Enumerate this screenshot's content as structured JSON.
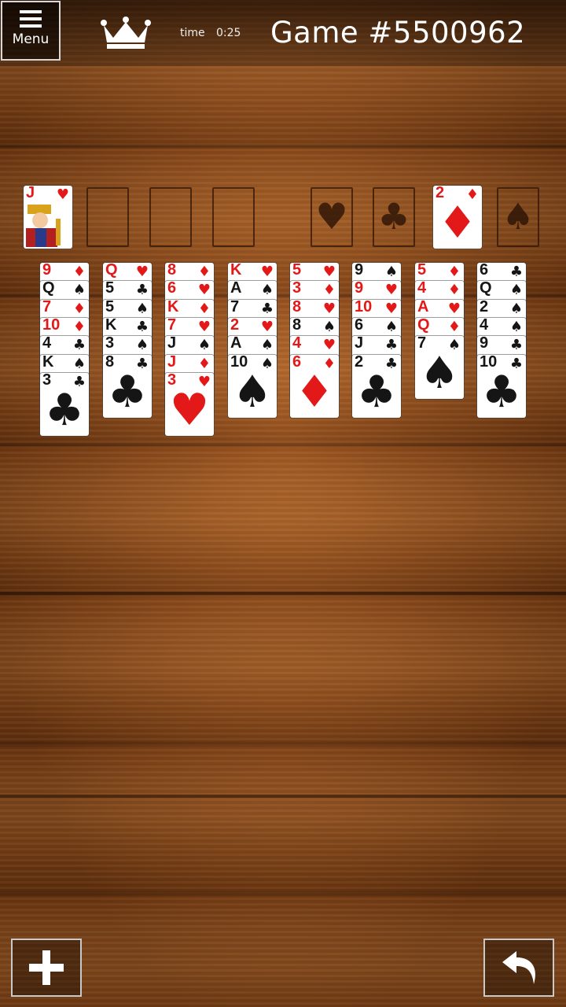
{
  "header": {
    "menu_label": "Menu",
    "time_label": "time",
    "time_value": "0:25",
    "game_title": "Game  #5500962"
  },
  "freecells": [
    {
      "card": {
        "rank": "J",
        "suit": "♥",
        "color": "red",
        "face": true
      }
    },
    {
      "card": null
    },
    {
      "card": null
    },
    {
      "card": null
    }
  ],
  "foundations": [
    {
      "suit_hint": "♥",
      "card": null
    },
    {
      "suit_hint": "♣",
      "card": null
    },
    {
      "suit_hint": "♦",
      "card": {
        "rank": "2",
        "suit": "♦",
        "color": "red"
      }
    },
    {
      "suit_hint": "♠",
      "card": null
    }
  ],
  "tableau": [
    [
      [
        "9",
        "♦"
      ],
      [
        "Q",
        "♠"
      ],
      [
        "7",
        "♦"
      ],
      [
        "10",
        "♦"
      ],
      [
        "4",
        "♣"
      ],
      [
        "K",
        "♠"
      ],
      [
        "3",
        "♣"
      ]
    ],
    [
      [
        "Q",
        "♥"
      ],
      [
        "5",
        "♣"
      ],
      [
        "5",
        "♠"
      ],
      [
        "K",
        "♣"
      ],
      [
        "3",
        "♠"
      ],
      [
        "8",
        "♣"
      ]
    ],
    [
      [
        "8",
        "♦"
      ],
      [
        "6",
        "♥"
      ],
      [
        "K",
        "♦"
      ],
      [
        "7",
        "♥"
      ],
      [
        "J",
        "♠"
      ],
      [
        "J",
        "♦"
      ],
      [
        "3",
        "♥"
      ]
    ],
    [
      [
        "K",
        "♥"
      ],
      [
        "A",
        "♠"
      ],
      [
        "7",
        "♣"
      ],
      [
        "2",
        "♥"
      ],
      [
        "A",
        "♠"
      ],
      [
        "10",
        "♠"
      ]
    ],
    [
      [
        "5",
        "♥"
      ],
      [
        "3",
        "♦"
      ],
      [
        "8",
        "♥"
      ],
      [
        "8",
        "♠"
      ],
      [
        "4",
        "♥"
      ],
      [
        "6",
        "♦"
      ]
    ],
    [
      [
        "9",
        "♠"
      ],
      [
        "9",
        "♥"
      ],
      [
        "10",
        "♥"
      ],
      [
        "6",
        "♠"
      ],
      [
        "J",
        "♣"
      ],
      [
        "2",
        "♣"
      ]
    ],
    [
      [
        "5",
        "♦"
      ],
      [
        "4",
        "♦"
      ],
      [
        "A",
        "♥"
      ],
      [
        "Q",
        "♦"
      ],
      [
        "7",
        "♠"
      ]
    ],
    [
      [
        "6",
        "♣"
      ],
      [
        "Q",
        "♠"
      ],
      [
        "2",
        "♠"
      ],
      [
        "4",
        "♠"
      ],
      [
        "9",
        "♣"
      ],
      [
        "10",
        "♣"
      ]
    ]
  ],
  "colors": {
    "red": "#e31818",
    "black": "#151515"
  },
  "buttons": {
    "new_game_icon": "plus-icon",
    "undo_icon": "undo-icon"
  }
}
